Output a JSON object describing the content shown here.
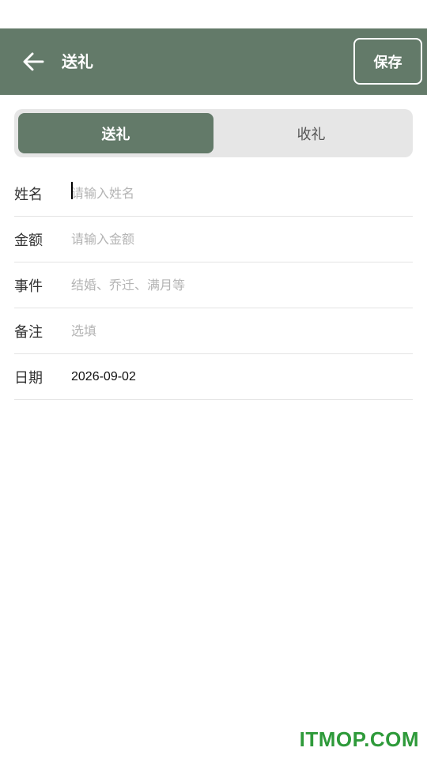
{
  "app_bar": {
    "title": "送礼",
    "save_label": "保存"
  },
  "segment": {
    "active": "送礼",
    "inactive": "收礼"
  },
  "form": {
    "rows": [
      {
        "label": "姓名",
        "placeholder": "请输入姓名",
        "value": ""
      },
      {
        "label": "金额",
        "placeholder": "请输入金额",
        "value": ""
      },
      {
        "label": "事件",
        "placeholder": "结婚、乔迁、满月等",
        "value": ""
      },
      {
        "label": "备注",
        "placeholder": "选填",
        "value": ""
      },
      {
        "label": "日期",
        "value": "2026-09-02"
      }
    ]
  },
  "watermark": "ITMOP.COM",
  "colors": {
    "primary": "#637a69",
    "segment_bg": "#e6e6e6",
    "watermark": "#2e9a3a"
  },
  "icons": {
    "back": "arrow-left-icon"
  }
}
